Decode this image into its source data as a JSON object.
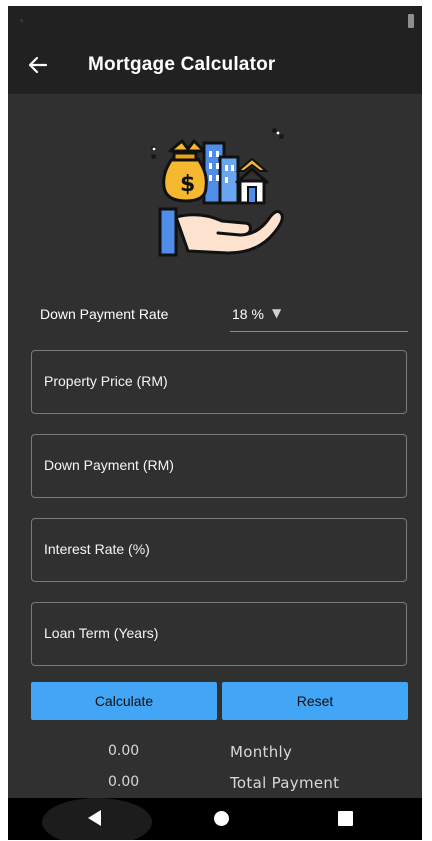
{
  "app_bar": {
    "title": "Mortgage Calculator",
    "back_icon": "arrow-left-icon"
  },
  "illustration": {
    "icon": "hand-holding-money-and-buildings-icon",
    "money_symbol": "$"
  },
  "down_payment": {
    "label": "Down Payment Rate",
    "selected": "18 %"
  },
  "fields": {
    "property_price": {
      "label": "Property Price (RM)"
    },
    "down_payment": {
      "label": "Down Payment (RM)"
    },
    "interest_rate": {
      "label": "Interest Rate (%)"
    },
    "loan_term": {
      "label": "Loan Term (Years)"
    }
  },
  "buttons": {
    "calculate": "Calculate",
    "reset": "Reset"
  },
  "results": {
    "monthly": {
      "value": "0.00",
      "label": "Monthly"
    },
    "total": {
      "value": "0.00",
      "label": "Total Payment"
    }
  },
  "colors": {
    "background": "#303030",
    "app_bar": "#212121",
    "button": "#42a5f5",
    "nav_bar": "#000000"
  }
}
